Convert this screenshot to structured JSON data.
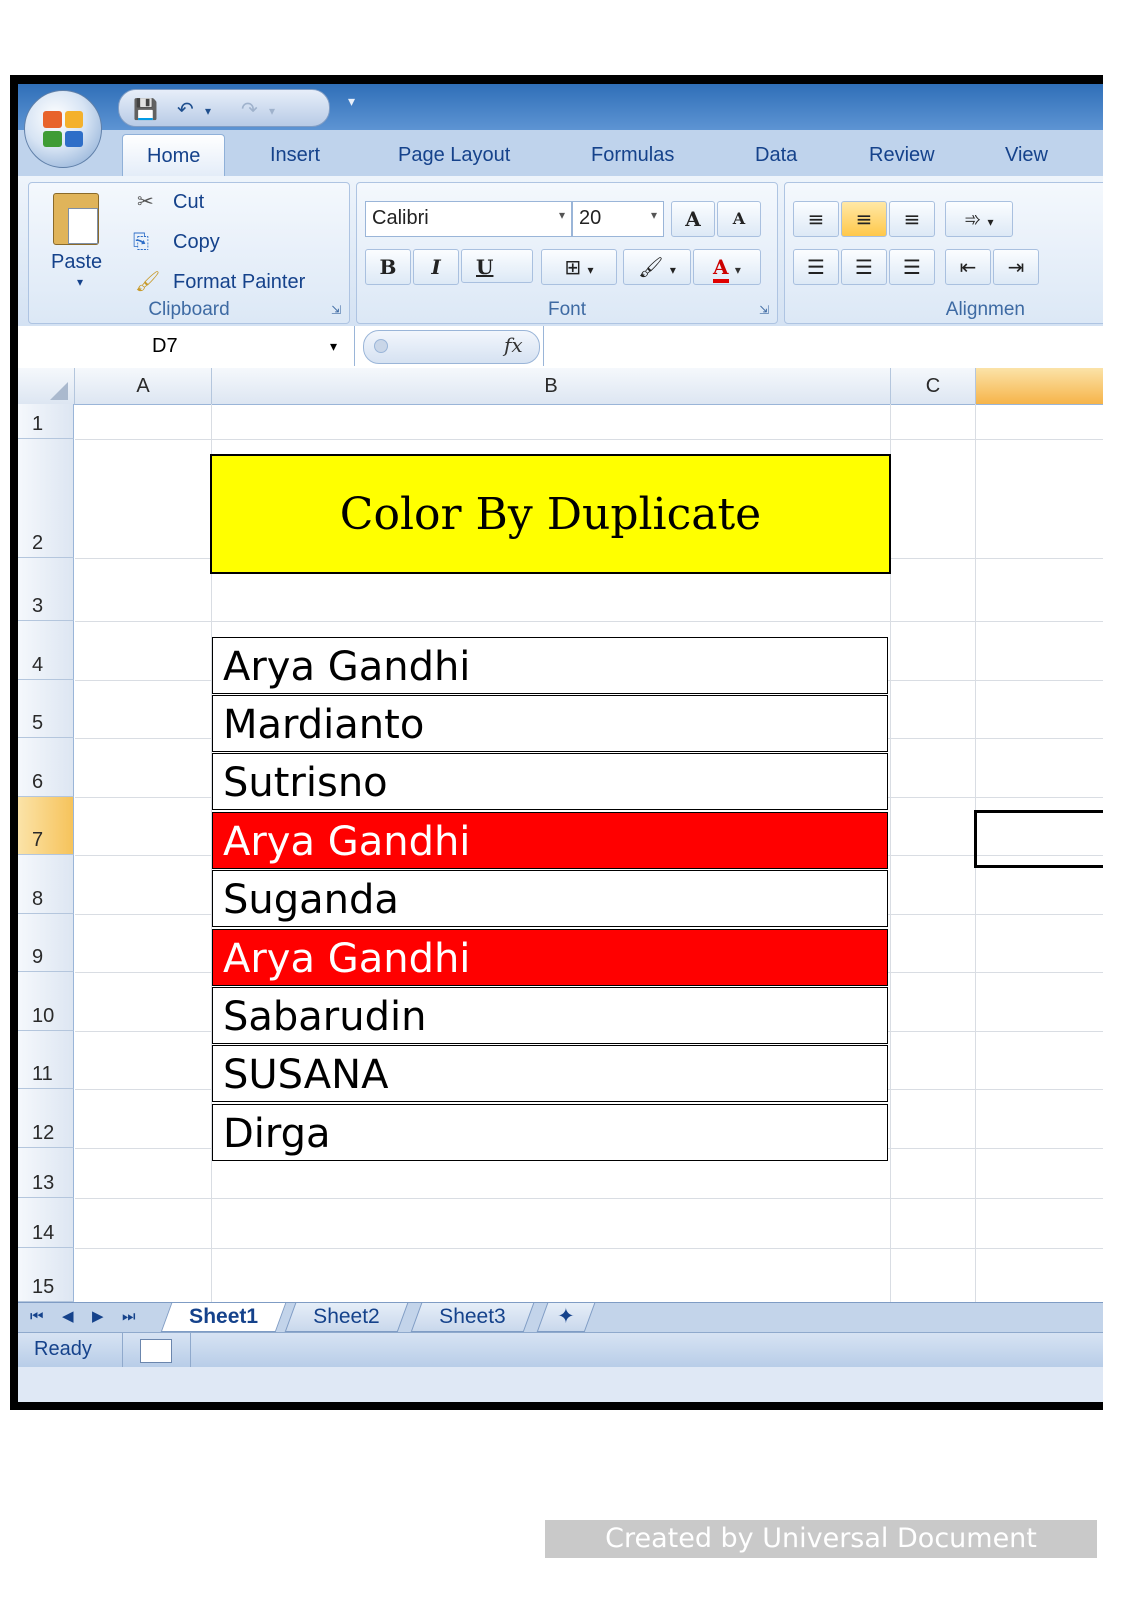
{
  "ribbon": {
    "tabs": [
      "Home",
      "Insert",
      "Page Layout",
      "Formulas",
      "Data",
      "Review",
      "View"
    ],
    "clipboard": {
      "paste": "Paste",
      "cut": "Cut",
      "copy": "Copy",
      "format_painter": "Format Painter",
      "label": "Clipboard"
    },
    "font": {
      "name": "Calibri",
      "size": "20",
      "label": "Font",
      "bold": "B",
      "italic": "I",
      "underline": "U",
      "grow": "A",
      "shrink": "A",
      "font_color": "A"
    },
    "alignment": {
      "label": "Alignmen"
    }
  },
  "formula_bar": {
    "cell_ref": "D7",
    "fx": "fx",
    "value": ""
  },
  "columns": [
    "A",
    "B",
    "C"
  ],
  "rows": [
    "1",
    "2",
    "3",
    "4",
    "5",
    "6",
    "7",
    "8",
    "9",
    "10",
    "11",
    "12",
    "13",
    "14",
    "15"
  ],
  "sheet": {
    "title": "Color By Duplicate",
    "names": [
      {
        "row": "4",
        "text": "Arya Gandhi",
        "duplicate": false
      },
      {
        "row": "5",
        "text": "Mardianto",
        "duplicate": false
      },
      {
        "row": "6",
        "text": "Sutrisno",
        "duplicate": false
      },
      {
        "row": "7",
        "text": "Arya Gandhi",
        "duplicate": true
      },
      {
        "row": "8",
        "text": "Suganda",
        "duplicate": false
      },
      {
        "row": "9",
        "text": "Arya Gandhi",
        "duplicate": true
      },
      {
        "row": "10",
        "text": "Sabarudin",
        "duplicate": false
      },
      {
        "row": "11",
        "text": "SUSANA",
        "duplicate": false
      },
      {
        "row": "12",
        "text": "Dirga",
        "duplicate": false
      }
    ],
    "duplicate_fill": "#ff0000",
    "title_fill": "#ffff00"
  },
  "sheet_tabs": [
    "Sheet1",
    "Sheet2",
    "Sheet3"
  ],
  "status": {
    "text": "Ready"
  },
  "watermark": "Created by Universal Document Converter"
}
